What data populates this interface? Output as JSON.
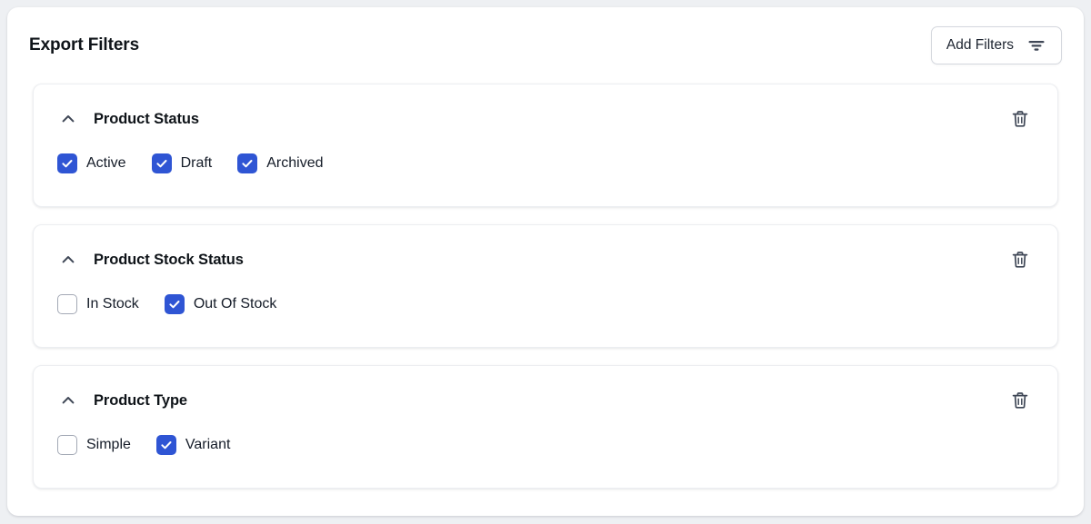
{
  "header": {
    "title": "Export Filters",
    "add_filters_label": "Add Filters",
    "add_filters_icon": "filter-lines-icon"
  },
  "theme": {
    "page_background": "#eef0f3",
    "panel_background": "#ffffff",
    "accent_checkbox": "#2f55d4",
    "checkbox_border_unchecked": "#a3a9b5",
    "text_primary": "#0f1419",
    "card_border": "#eceef1",
    "button_border": "#d4d7dd",
    "icon_color": "#3f4756"
  },
  "filter_groups": [
    {
      "title": "Product Status",
      "collapse_icon": "chevron-up-icon",
      "delete_icon": "trash-icon",
      "options": [
        {
          "label": "Active",
          "checked": true
        },
        {
          "label": "Draft",
          "checked": true
        },
        {
          "label": "Archived",
          "checked": true
        }
      ]
    },
    {
      "title": "Product Stock Status",
      "collapse_icon": "chevron-up-icon",
      "delete_icon": "trash-icon",
      "options": [
        {
          "label": "In Stock",
          "checked": false
        },
        {
          "label": "Out Of Stock",
          "checked": true
        }
      ]
    },
    {
      "title": "Product Type",
      "collapse_icon": "chevron-up-icon",
      "delete_icon": "trash-icon",
      "options": [
        {
          "label": "Simple",
          "checked": false
        },
        {
          "label": "Variant",
          "checked": true
        }
      ]
    }
  ]
}
